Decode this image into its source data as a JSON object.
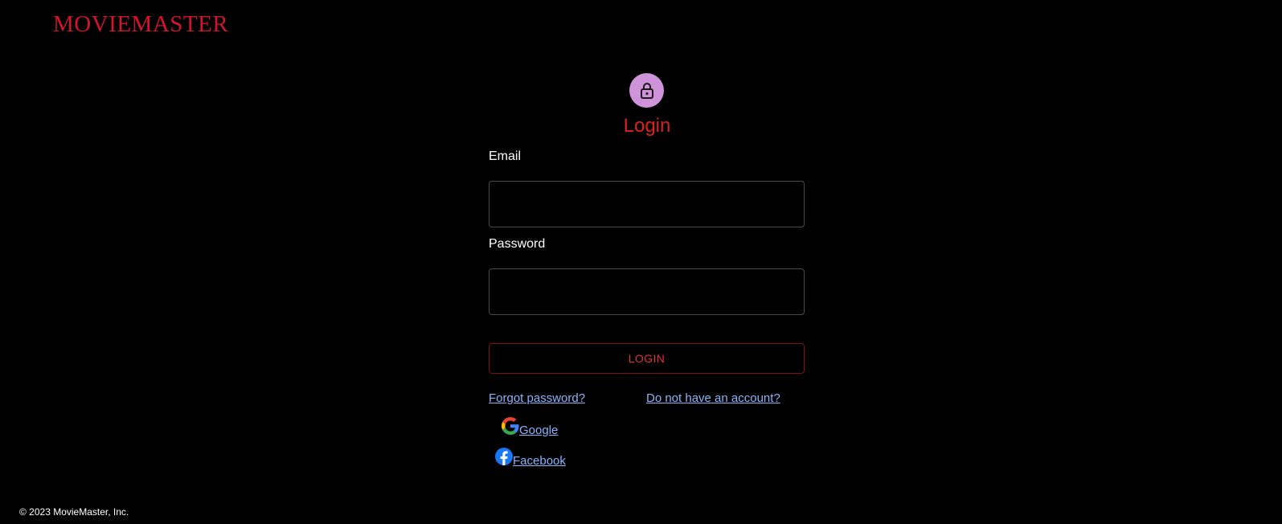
{
  "header": {
    "brand": "MOVIEMASTER"
  },
  "login_form": {
    "icon": "lock-icon",
    "title": "Login",
    "email_label": "Email",
    "email_value": "",
    "password_label": "Password",
    "password_value": "",
    "submit_label": "LOGIN",
    "forgot_password": "Forgot password?",
    "signup": "Do not have an account?",
    "social": [
      {
        "icon": "google-icon",
        "label": "Google"
      },
      {
        "icon": "facebook-icon",
        "label": "Facebook"
      }
    ]
  },
  "footer": {
    "copyright": "© 2023 MovieMaster, Inc."
  },
  "colors": {
    "background": "#000000",
    "brand": "#d4142a",
    "title": "#e01f1f",
    "avatar": "#ce93d8",
    "link": "#8ab4f8",
    "button_border": "#7a1414",
    "button_text": "#e53030"
  }
}
